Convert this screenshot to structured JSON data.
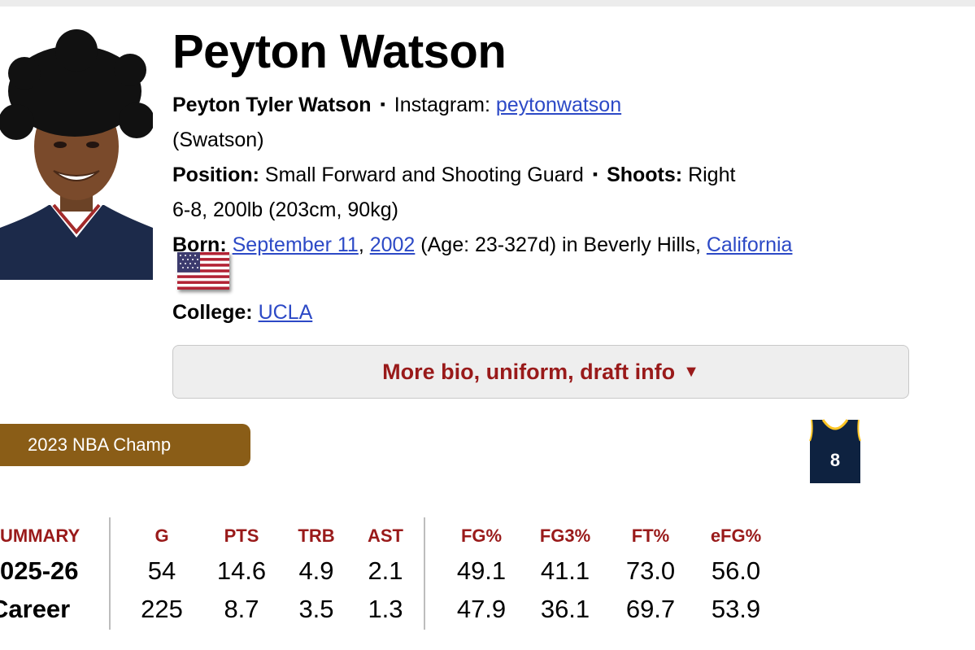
{
  "player": {
    "name": "Peyton Watson",
    "full_name": "Peyton Tyler Watson",
    "instagram_label": "Instagram:",
    "instagram_handle": "peytonwatson",
    "nickname": "(Swatson)",
    "position_label": "Position:",
    "position": "Small Forward and Shooting Guard",
    "shoots_label": "Shoots:",
    "shoots": "Right",
    "size": "6-8, 200lb (203cm, 90kg)",
    "born_label": "Born:",
    "birth_month_day": "September 11",
    "birth_year": "2002",
    "age_text": "(Age: 23-327d) in Beverly Hills,",
    "birth_state": "California",
    "college_label": "College:",
    "college": "UCLA",
    "separator": "▪",
    "comma": ","
  },
  "more_button": {
    "label": "More bio, uniform, draft info",
    "arrow": "▼"
  },
  "award": "2023 NBA Champ",
  "jersey": {
    "number": "8",
    "icon": "jersey-icon",
    "color": "#0e2240",
    "trim": "#fec524"
  },
  "colors": {
    "accent": "#991a1a",
    "link": "#2c49c6",
    "award_bg": "#8a5d17"
  },
  "stats": {
    "summary_label": "UMMARY",
    "headers": [
      "G",
      "PTS",
      "TRB",
      "AST",
      "FG%",
      "FG3%",
      "FT%",
      "eFG%"
    ],
    "rows": [
      {
        "label": "025-26",
        "values": [
          "54",
          "14.6",
          "4.9",
          "2.1",
          "49.1",
          "41.1",
          "73.0",
          "56.0"
        ]
      },
      {
        "label": "Career",
        "values": [
          "225",
          "8.7",
          "3.5",
          "1.3",
          "47.9",
          "36.1",
          "69.7",
          "53.9"
        ]
      }
    ]
  }
}
